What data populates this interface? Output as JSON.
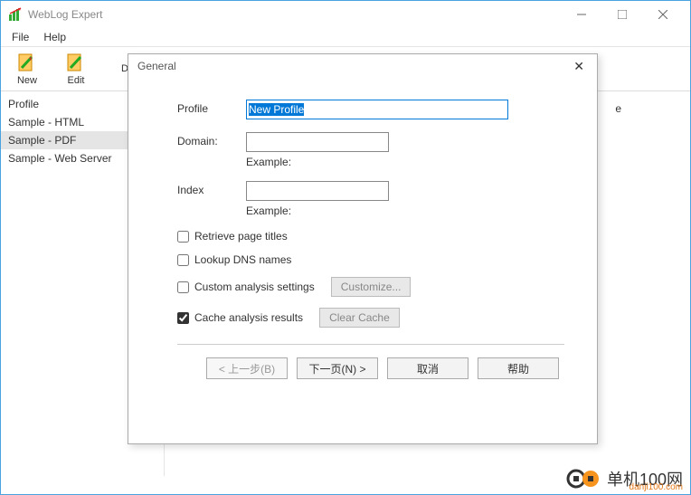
{
  "window": {
    "title": "WebLog Expert",
    "menus": [
      "File",
      "Help"
    ]
  },
  "toolbar": {
    "items": [
      {
        "label": "New"
      },
      {
        "label": "Edit"
      },
      {
        "label": "D"
      }
    ]
  },
  "sidebar": {
    "items": [
      {
        "label": "Profile",
        "selected": false
      },
      {
        "label": "Sample - HTML",
        "selected": false
      },
      {
        "label": "Sample - PDF",
        "selected": true
      },
      {
        "label": "Sample - Web Server",
        "selected": false
      }
    ]
  },
  "main": {
    "visible_char": "e"
  },
  "dialog": {
    "title": "General",
    "fields": {
      "profile_label": "Profile",
      "profile_value": "New Profile",
      "domain_label": "Domain:",
      "domain_value": "",
      "domain_example": "Example:",
      "index_label": "Index",
      "index_value": "",
      "index_example": "Example:"
    },
    "checkboxes": {
      "retrieve": {
        "label": "Retrieve page titles",
        "checked": false
      },
      "dns": {
        "label": "Lookup DNS names",
        "checked": false
      },
      "custom": {
        "label": "Custom analysis settings",
        "checked": false,
        "button": "Customize..."
      },
      "cache": {
        "label": "Cache analysis results",
        "checked": true,
        "button": "Clear Cache"
      }
    },
    "buttons": {
      "back": "< 上一步(B)",
      "next": "下一页(N) >",
      "cancel": "取消",
      "help": "帮助"
    }
  },
  "watermark": {
    "text": "单机100网",
    "url": "danji100.com"
  }
}
